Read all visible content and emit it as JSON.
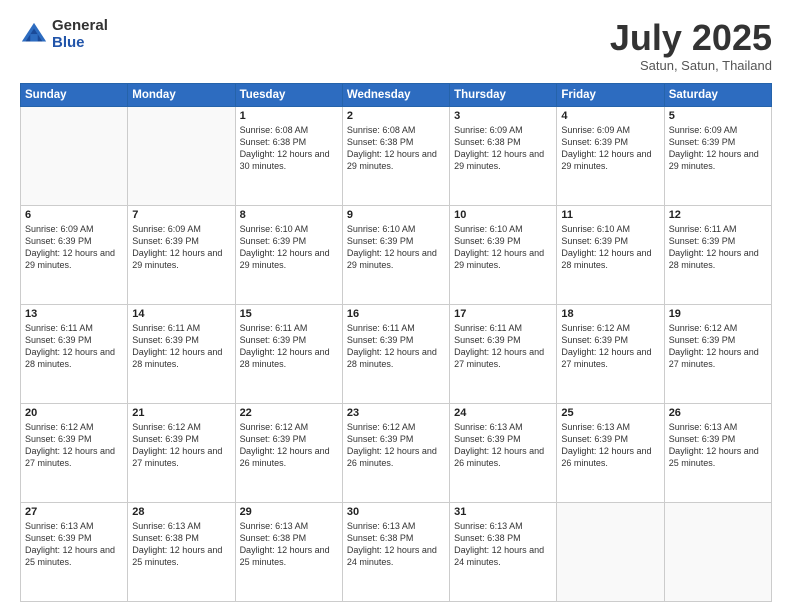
{
  "logo": {
    "general": "General",
    "blue": "Blue"
  },
  "header": {
    "month": "July 2025",
    "location": "Satun, Satun, Thailand"
  },
  "weekdays": [
    "Sunday",
    "Monday",
    "Tuesday",
    "Wednesday",
    "Thursday",
    "Friday",
    "Saturday"
  ],
  "weeks": [
    [
      {
        "day": "",
        "info": ""
      },
      {
        "day": "",
        "info": ""
      },
      {
        "day": "1",
        "info": "Sunrise: 6:08 AM\nSunset: 6:38 PM\nDaylight: 12 hours and 30 minutes."
      },
      {
        "day": "2",
        "info": "Sunrise: 6:08 AM\nSunset: 6:38 PM\nDaylight: 12 hours and 29 minutes."
      },
      {
        "day": "3",
        "info": "Sunrise: 6:09 AM\nSunset: 6:38 PM\nDaylight: 12 hours and 29 minutes."
      },
      {
        "day": "4",
        "info": "Sunrise: 6:09 AM\nSunset: 6:39 PM\nDaylight: 12 hours and 29 minutes."
      },
      {
        "day": "5",
        "info": "Sunrise: 6:09 AM\nSunset: 6:39 PM\nDaylight: 12 hours and 29 minutes."
      }
    ],
    [
      {
        "day": "6",
        "info": "Sunrise: 6:09 AM\nSunset: 6:39 PM\nDaylight: 12 hours and 29 minutes."
      },
      {
        "day": "7",
        "info": "Sunrise: 6:09 AM\nSunset: 6:39 PM\nDaylight: 12 hours and 29 minutes."
      },
      {
        "day": "8",
        "info": "Sunrise: 6:10 AM\nSunset: 6:39 PM\nDaylight: 12 hours and 29 minutes."
      },
      {
        "day": "9",
        "info": "Sunrise: 6:10 AM\nSunset: 6:39 PM\nDaylight: 12 hours and 29 minutes."
      },
      {
        "day": "10",
        "info": "Sunrise: 6:10 AM\nSunset: 6:39 PM\nDaylight: 12 hours and 29 minutes."
      },
      {
        "day": "11",
        "info": "Sunrise: 6:10 AM\nSunset: 6:39 PM\nDaylight: 12 hours and 28 minutes."
      },
      {
        "day": "12",
        "info": "Sunrise: 6:11 AM\nSunset: 6:39 PM\nDaylight: 12 hours and 28 minutes."
      }
    ],
    [
      {
        "day": "13",
        "info": "Sunrise: 6:11 AM\nSunset: 6:39 PM\nDaylight: 12 hours and 28 minutes."
      },
      {
        "day": "14",
        "info": "Sunrise: 6:11 AM\nSunset: 6:39 PM\nDaylight: 12 hours and 28 minutes."
      },
      {
        "day": "15",
        "info": "Sunrise: 6:11 AM\nSunset: 6:39 PM\nDaylight: 12 hours and 28 minutes."
      },
      {
        "day": "16",
        "info": "Sunrise: 6:11 AM\nSunset: 6:39 PM\nDaylight: 12 hours and 28 minutes."
      },
      {
        "day": "17",
        "info": "Sunrise: 6:11 AM\nSunset: 6:39 PM\nDaylight: 12 hours and 27 minutes."
      },
      {
        "day": "18",
        "info": "Sunrise: 6:12 AM\nSunset: 6:39 PM\nDaylight: 12 hours and 27 minutes."
      },
      {
        "day": "19",
        "info": "Sunrise: 6:12 AM\nSunset: 6:39 PM\nDaylight: 12 hours and 27 minutes."
      }
    ],
    [
      {
        "day": "20",
        "info": "Sunrise: 6:12 AM\nSunset: 6:39 PM\nDaylight: 12 hours and 27 minutes."
      },
      {
        "day": "21",
        "info": "Sunrise: 6:12 AM\nSunset: 6:39 PM\nDaylight: 12 hours and 27 minutes."
      },
      {
        "day": "22",
        "info": "Sunrise: 6:12 AM\nSunset: 6:39 PM\nDaylight: 12 hours and 26 minutes."
      },
      {
        "day": "23",
        "info": "Sunrise: 6:12 AM\nSunset: 6:39 PM\nDaylight: 12 hours and 26 minutes."
      },
      {
        "day": "24",
        "info": "Sunrise: 6:13 AM\nSunset: 6:39 PM\nDaylight: 12 hours and 26 minutes."
      },
      {
        "day": "25",
        "info": "Sunrise: 6:13 AM\nSunset: 6:39 PM\nDaylight: 12 hours and 26 minutes."
      },
      {
        "day": "26",
        "info": "Sunrise: 6:13 AM\nSunset: 6:39 PM\nDaylight: 12 hours and 25 minutes."
      }
    ],
    [
      {
        "day": "27",
        "info": "Sunrise: 6:13 AM\nSunset: 6:39 PM\nDaylight: 12 hours and 25 minutes."
      },
      {
        "day": "28",
        "info": "Sunrise: 6:13 AM\nSunset: 6:38 PM\nDaylight: 12 hours and 25 minutes."
      },
      {
        "day": "29",
        "info": "Sunrise: 6:13 AM\nSunset: 6:38 PM\nDaylight: 12 hours and 25 minutes."
      },
      {
        "day": "30",
        "info": "Sunrise: 6:13 AM\nSunset: 6:38 PM\nDaylight: 12 hours and 24 minutes."
      },
      {
        "day": "31",
        "info": "Sunrise: 6:13 AM\nSunset: 6:38 PM\nDaylight: 12 hours and 24 minutes."
      },
      {
        "day": "",
        "info": ""
      },
      {
        "day": "",
        "info": ""
      }
    ]
  ]
}
